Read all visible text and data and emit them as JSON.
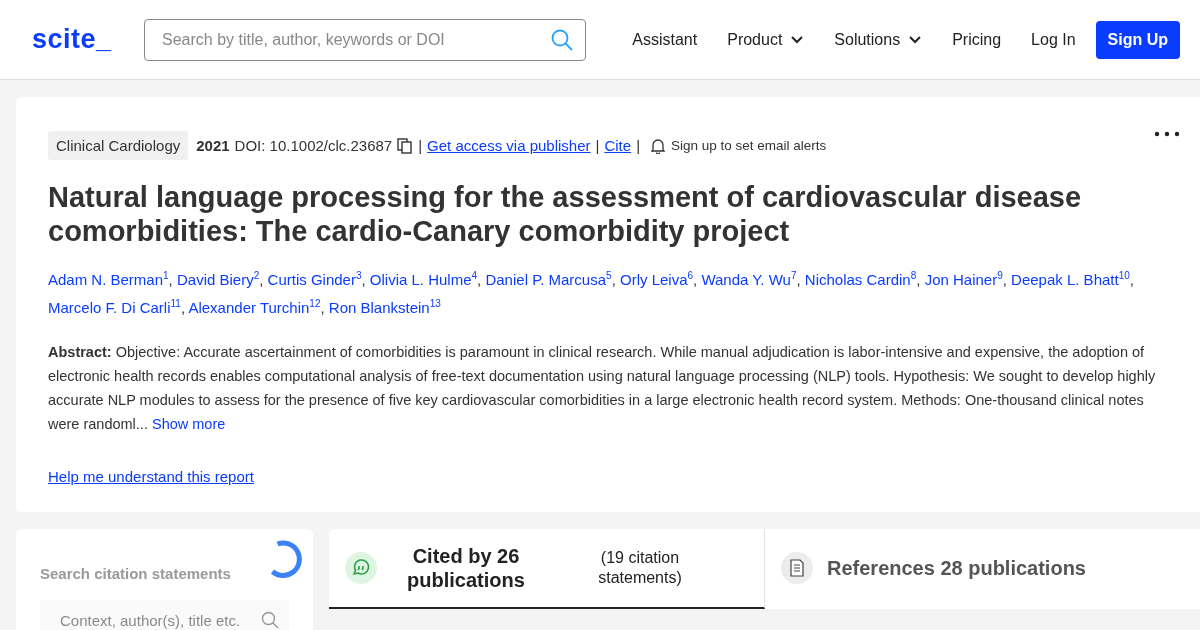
{
  "header": {
    "logo": "scite_",
    "search": {
      "placeholder": "Search by title, author, keywords or DOI"
    },
    "nav": [
      {
        "label": "Assistant",
        "dropdown": false
      },
      {
        "label": "Product",
        "dropdown": true
      },
      {
        "label": "Solutions",
        "dropdown": true
      },
      {
        "label": "Pricing",
        "dropdown": false
      },
      {
        "label": "Log In",
        "dropdown": false
      }
    ],
    "signup": "Sign Up"
  },
  "paper": {
    "journal": "Clinical Cardiology",
    "year": "2021",
    "doi": "DOI: 10.1002/clc.23687",
    "meta": [
      {
        "kind": "copy"
      },
      {
        "kind": "sep",
        "text": "|"
      },
      {
        "kind": "link",
        "text": "Get access via publisher"
      },
      {
        "kind": "sep",
        "text": "|"
      },
      {
        "kind": "link",
        "text": "Cite"
      },
      {
        "kind": "sep",
        "text": "|"
      },
      {
        "kind": "alert",
        "text": "Sign up to set email alerts"
      }
    ],
    "title": "Natural language processing for the assessment of cardiovascular disease comorbidities: The cardio-Canary comorbidity project",
    "authors": [
      {
        "name": "Adam N. Berman$^{1}$",
        "separator": ","
      },
      {
        "name": "David Biery$^{2}$",
        "separator": ","
      },
      {
        "name": "Curtis Ginder$^{3}$",
        "separator": ","
      },
      {
        "name": "Olivia L. Hulme$^{4}$",
        "separator": ","
      },
      {
        "name": "Daniel P. Marcusa$^{5}$",
        "separator": ","
      },
      {
        "name": "Orly Leiva$^{6}$",
        "separator": ","
      },
      {
        "name": "Wanda Y. Wu$^{7}$",
        "separator": ","
      },
      {
        "name": "Nicholas Cardin$^{8}$",
        "separator": ","
      },
      {
        "name": "Jon Hainer$^{9}$",
        "separator": ","
      },
      {
        "name": "Deepak L. Bhatt$^{10}$",
        "separator": ","
      },
      {
        "name": "Marcelo F. Di Carli$^{11}$",
        "separator": ","
      },
      {
        "name": "Alexander Turchin$^{12}$",
        "separator": ","
      },
      {
        "name": "Ron Blankstein$^{13}$"
      }
    ],
    "abstract": "**Abstract:** Objective: Accurate ascertainment of comorbidities is paramount in clinical research. While manual adjudication is labor-intensive and expensive, the adoption of electronic health records enables computational analysis of free-text documentation using natural language processing (NLP) tools. Hypothesis: We sought to develop highly accurate NLP modules to assess for the presence of five key cardiovascular comorbidities in a large electronic health record system. Methods: One-thousand clinical notes were randoml...",
    "show_more": "Show more",
    "help_link": "Help me understand this report"
  },
  "citation_search": {
    "label": "Search citation statements",
    "placeholder": "Context, author(s), title etc.",
    "loading": true
  },
  "tabs": [
    {
      "kind": "cited",
      "title": "Cited by 26 publications",
      "subtitle": "(19 citation statements)",
      "selected": true
    },
    {
      "kind": "references",
      "title": "References 28 publications",
      "selected": false
    }
  ]
}
